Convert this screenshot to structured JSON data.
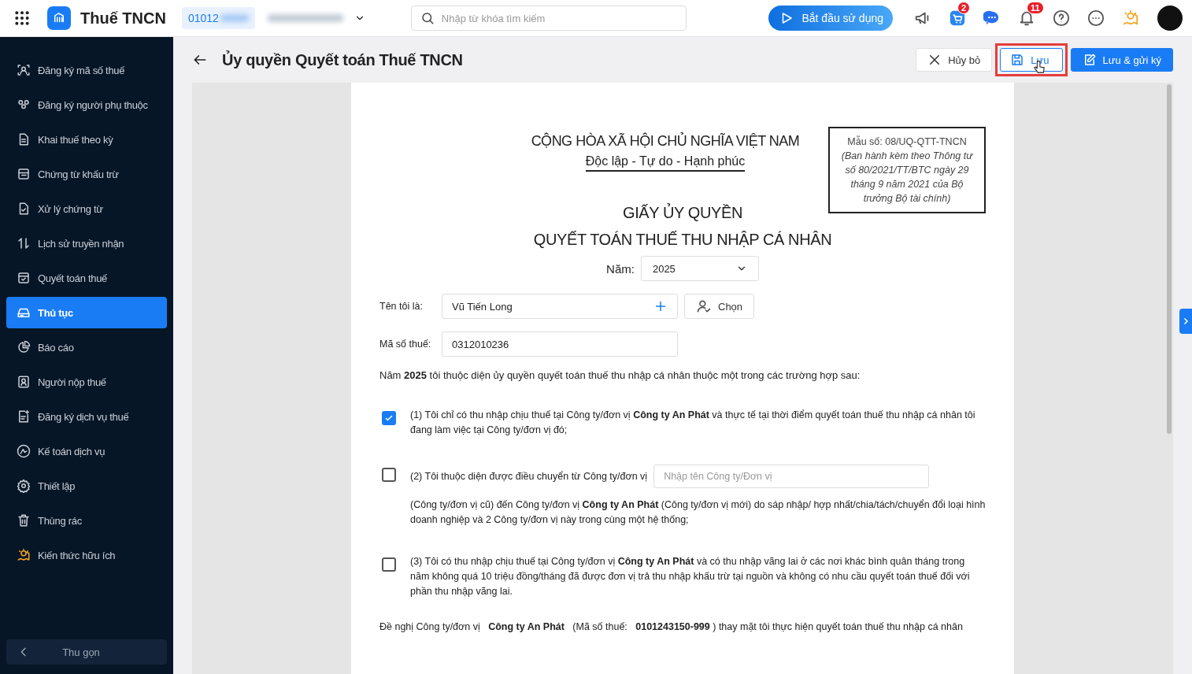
{
  "app": {
    "title": "Thuế TNCN",
    "tax_code": "01012",
    "search": {
      "placeholder": "Nhập từ khóa tìm kiếm"
    },
    "start_button": "Bắt đầu sử dụng",
    "cart_badge": "2",
    "notification_badge": "11"
  },
  "sidebar": {
    "items": [
      {
        "label": "Đăng ký mã số thuế",
        "selected": false
      },
      {
        "label": "Đăng ký người phụ thuộc",
        "selected": false
      },
      {
        "label": "Khai thuế theo kỳ",
        "selected": false
      },
      {
        "label": "Chứng từ khấu trừ",
        "selected": false
      },
      {
        "label": "Xử lý chứng từ",
        "selected": false
      },
      {
        "label": "Lịch sử truyền nhận",
        "selected": false
      },
      {
        "label": "Quyết toán thuế",
        "selected": false
      },
      {
        "label": "Thủ tục",
        "selected": true
      },
      {
        "label": "Báo cáo",
        "selected": false
      },
      {
        "label": "Người nộp thuế",
        "selected": false
      },
      {
        "label": "Đăng ký dịch vụ thuế",
        "selected": false
      },
      {
        "label": "Kế toán dịch vụ",
        "selected": false
      },
      {
        "label": "Thiết lập",
        "selected": false
      },
      {
        "label": "Thùng rác",
        "selected": false
      },
      {
        "label": "Kiến thức hữu ích",
        "selected": false
      }
    ],
    "collapse": "Thu gọn"
  },
  "page": {
    "title": "Ủy quyền Quyết toán Thuế TNCN",
    "buttons": [
      {
        "label": "Hủy bỏ",
        "kind": "cancel",
        "highlighted": false
      },
      {
        "label": "Lưu",
        "kind": "save",
        "highlighted": true
      },
      {
        "label": "Lưu & gửi ký",
        "kind": "primary",
        "highlighted": false
      }
    ]
  },
  "form": {
    "national_title": "CỘNG HÒA XÃ HỘI CHỦ NGHĨA VIỆT NAM",
    "motto": "Độc lập - Tự do - Hạnh phúc",
    "template_code": "Mẫu số: 08/UQ-QTT-TNCN",
    "template_note": "(Ban hành kèm theo Thông tư số 80/2021/TT/BTC ngày 29 tháng 9 năm 2021 của Bộ trưởng Bộ tài chính)",
    "doc_title": [
      "GIẤY ỦY QUYỀN",
      "QUYẾT TOÁN THUẾ THU NHẬP CÁ NHÂN"
    ],
    "year": {
      "label": "Năm:",
      "value": "2025"
    },
    "name": {
      "label": "Tên tôi là:",
      "value": "Vũ Tiến Long",
      "choose_button": "Chọn"
    },
    "tax_code": {
      "label": "Mã số thuế:",
      "value": "0312010236"
    },
    "intro": "Năm **2025** tôi thuộc diện ủy quyền quyết toán thuế thu nhập cá nhân thuộc một trong các trường hợp sau:",
    "options": [
      {
        "checked": true,
        "text": "(1) Tôi chỉ có thu nhập chịu thuế tại Công ty/đơn vị **Công ty An Phát** và thực tế tại thời điểm quyết toán thuế thu nhập cá nhân tôi đang làm việc tại Công ty/đơn vị đó;"
      },
      {
        "checked": false,
        "text": "(2) Tôi thuộc diện được điều chuyển từ Công ty/đơn vị",
        "placeholder": "Nhập tên Công ty/Đơn vị",
        "continuation": "(Công ty/đơn vị cũ) đến Công ty/đơn vị **Công ty An Phát** (Công ty/đơn vị mới) do sáp nhập/ hợp nhất/chia/tách/chuyển đổi loại hình doanh nghiệp và 2 Công ty/đơn vị này trong cùng một hệ thống;"
      },
      {
        "checked": false,
        "text": "(3) Tôi có thu nhập chịu thuế tại Công ty/đơn vị **Công ty An Phát** và có thu nhập vãng lai ở các nơi khác bình quân tháng trong năm không quá 10 triệu đồng/tháng đã được đơn vị trả thu nhập khấu trừ tại nguồn và không có nhu cầu quyết toán thuế đối với phần thu nhập vãng lai."
      }
    ],
    "request": "Đề nghị Công ty/đơn vị   **Công ty An Phát**   (Mã số thuế:   **0101243150-999** ) thay mặt tôi thực hiện quyết toán thuế thu nhập cá nhân"
  }
}
